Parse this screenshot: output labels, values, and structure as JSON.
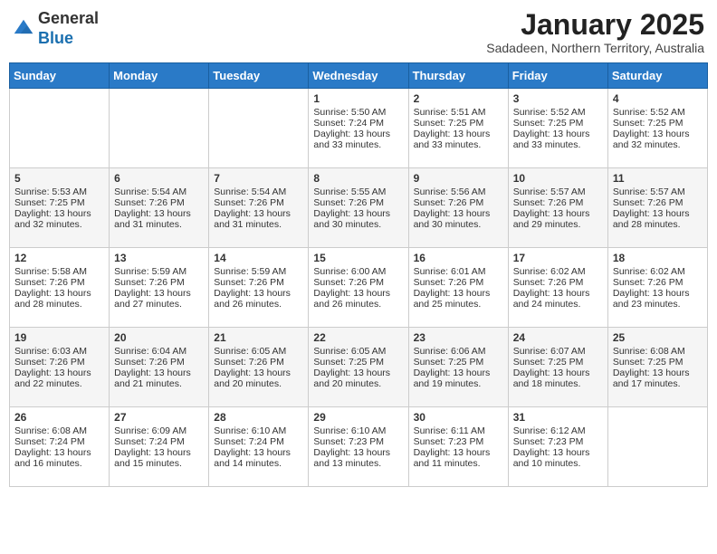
{
  "header": {
    "logo_line1": "General",
    "logo_line2": "Blue",
    "month": "January 2025",
    "location": "Sadadeen, Northern Territory, Australia"
  },
  "weekdays": [
    "Sunday",
    "Monday",
    "Tuesday",
    "Wednesday",
    "Thursday",
    "Friday",
    "Saturday"
  ],
  "weeks": [
    [
      {
        "day": "",
        "sunrise": "",
        "sunset": "",
        "daylight": ""
      },
      {
        "day": "",
        "sunrise": "",
        "sunset": "",
        "daylight": ""
      },
      {
        "day": "",
        "sunrise": "",
        "sunset": "",
        "daylight": ""
      },
      {
        "day": "1",
        "sunrise": "Sunrise: 5:50 AM",
        "sunset": "Sunset: 7:24 PM",
        "daylight": "Daylight: 13 hours and 33 minutes."
      },
      {
        "day": "2",
        "sunrise": "Sunrise: 5:51 AM",
        "sunset": "Sunset: 7:25 PM",
        "daylight": "Daylight: 13 hours and 33 minutes."
      },
      {
        "day": "3",
        "sunrise": "Sunrise: 5:52 AM",
        "sunset": "Sunset: 7:25 PM",
        "daylight": "Daylight: 13 hours and 33 minutes."
      },
      {
        "day": "4",
        "sunrise": "Sunrise: 5:52 AM",
        "sunset": "Sunset: 7:25 PM",
        "daylight": "Daylight: 13 hours and 32 minutes."
      }
    ],
    [
      {
        "day": "5",
        "sunrise": "Sunrise: 5:53 AM",
        "sunset": "Sunset: 7:25 PM",
        "daylight": "Daylight: 13 hours and 32 minutes."
      },
      {
        "day": "6",
        "sunrise": "Sunrise: 5:54 AM",
        "sunset": "Sunset: 7:26 PM",
        "daylight": "Daylight: 13 hours and 31 minutes."
      },
      {
        "day": "7",
        "sunrise": "Sunrise: 5:54 AM",
        "sunset": "Sunset: 7:26 PM",
        "daylight": "Daylight: 13 hours and 31 minutes."
      },
      {
        "day": "8",
        "sunrise": "Sunrise: 5:55 AM",
        "sunset": "Sunset: 7:26 PM",
        "daylight": "Daylight: 13 hours and 30 minutes."
      },
      {
        "day": "9",
        "sunrise": "Sunrise: 5:56 AM",
        "sunset": "Sunset: 7:26 PM",
        "daylight": "Daylight: 13 hours and 30 minutes."
      },
      {
        "day": "10",
        "sunrise": "Sunrise: 5:57 AM",
        "sunset": "Sunset: 7:26 PM",
        "daylight": "Daylight: 13 hours and 29 minutes."
      },
      {
        "day": "11",
        "sunrise": "Sunrise: 5:57 AM",
        "sunset": "Sunset: 7:26 PM",
        "daylight": "Daylight: 13 hours and 28 minutes."
      }
    ],
    [
      {
        "day": "12",
        "sunrise": "Sunrise: 5:58 AM",
        "sunset": "Sunset: 7:26 PM",
        "daylight": "Daylight: 13 hours and 28 minutes."
      },
      {
        "day": "13",
        "sunrise": "Sunrise: 5:59 AM",
        "sunset": "Sunset: 7:26 PM",
        "daylight": "Daylight: 13 hours and 27 minutes."
      },
      {
        "day": "14",
        "sunrise": "Sunrise: 5:59 AM",
        "sunset": "Sunset: 7:26 PM",
        "daylight": "Daylight: 13 hours and 26 minutes."
      },
      {
        "day": "15",
        "sunrise": "Sunrise: 6:00 AM",
        "sunset": "Sunset: 7:26 PM",
        "daylight": "Daylight: 13 hours and 26 minutes."
      },
      {
        "day": "16",
        "sunrise": "Sunrise: 6:01 AM",
        "sunset": "Sunset: 7:26 PM",
        "daylight": "Daylight: 13 hours and 25 minutes."
      },
      {
        "day": "17",
        "sunrise": "Sunrise: 6:02 AM",
        "sunset": "Sunset: 7:26 PM",
        "daylight": "Daylight: 13 hours and 24 minutes."
      },
      {
        "day": "18",
        "sunrise": "Sunrise: 6:02 AM",
        "sunset": "Sunset: 7:26 PM",
        "daylight": "Daylight: 13 hours and 23 minutes."
      }
    ],
    [
      {
        "day": "19",
        "sunrise": "Sunrise: 6:03 AM",
        "sunset": "Sunset: 7:26 PM",
        "daylight": "Daylight: 13 hours and 22 minutes."
      },
      {
        "day": "20",
        "sunrise": "Sunrise: 6:04 AM",
        "sunset": "Sunset: 7:26 PM",
        "daylight": "Daylight: 13 hours and 21 minutes."
      },
      {
        "day": "21",
        "sunrise": "Sunrise: 6:05 AM",
        "sunset": "Sunset: 7:26 PM",
        "daylight": "Daylight: 13 hours and 20 minutes."
      },
      {
        "day": "22",
        "sunrise": "Sunrise: 6:05 AM",
        "sunset": "Sunset: 7:25 PM",
        "daylight": "Daylight: 13 hours and 20 minutes."
      },
      {
        "day": "23",
        "sunrise": "Sunrise: 6:06 AM",
        "sunset": "Sunset: 7:25 PM",
        "daylight": "Daylight: 13 hours and 19 minutes."
      },
      {
        "day": "24",
        "sunrise": "Sunrise: 6:07 AM",
        "sunset": "Sunset: 7:25 PM",
        "daylight": "Daylight: 13 hours and 18 minutes."
      },
      {
        "day": "25",
        "sunrise": "Sunrise: 6:08 AM",
        "sunset": "Sunset: 7:25 PM",
        "daylight": "Daylight: 13 hours and 17 minutes."
      }
    ],
    [
      {
        "day": "26",
        "sunrise": "Sunrise: 6:08 AM",
        "sunset": "Sunset: 7:24 PM",
        "daylight": "Daylight: 13 hours and 16 minutes."
      },
      {
        "day": "27",
        "sunrise": "Sunrise: 6:09 AM",
        "sunset": "Sunset: 7:24 PM",
        "daylight": "Daylight: 13 hours and 15 minutes."
      },
      {
        "day": "28",
        "sunrise": "Sunrise: 6:10 AM",
        "sunset": "Sunset: 7:24 PM",
        "daylight": "Daylight: 13 hours and 14 minutes."
      },
      {
        "day": "29",
        "sunrise": "Sunrise: 6:10 AM",
        "sunset": "Sunset: 7:23 PM",
        "daylight": "Daylight: 13 hours and 13 minutes."
      },
      {
        "day": "30",
        "sunrise": "Sunrise: 6:11 AM",
        "sunset": "Sunset: 7:23 PM",
        "daylight": "Daylight: 13 hours and 11 minutes."
      },
      {
        "day": "31",
        "sunrise": "Sunrise: 6:12 AM",
        "sunset": "Sunset: 7:23 PM",
        "daylight": "Daylight: 13 hours and 10 minutes."
      },
      {
        "day": "",
        "sunrise": "",
        "sunset": "",
        "daylight": ""
      }
    ]
  ]
}
